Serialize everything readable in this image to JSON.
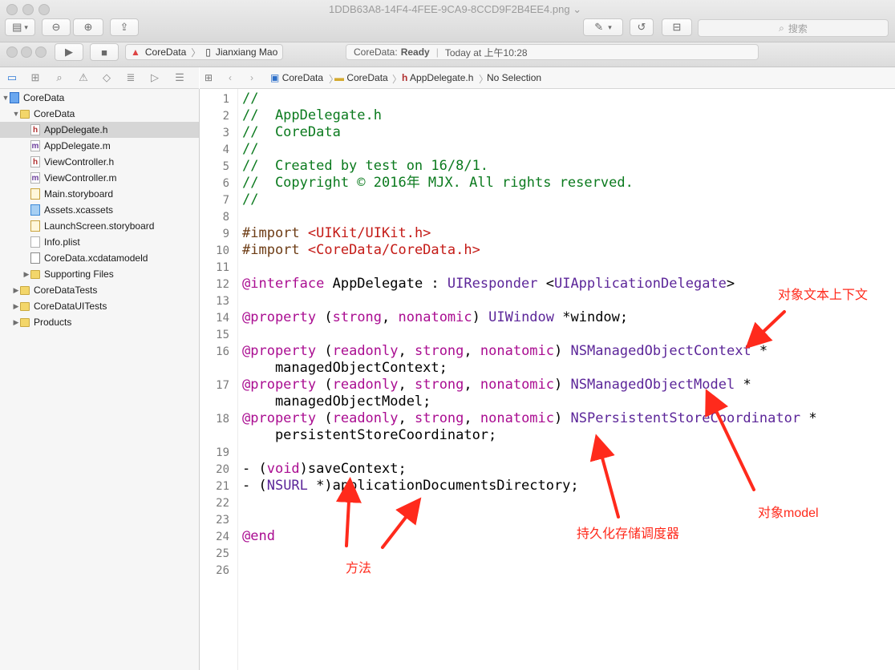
{
  "window": {
    "title": "1DDB63A8-14F4-4FEE-9CA9-8CCD9F2B4EE4.png",
    "title_chevron": "⌄",
    "search_placeholder": "搜索"
  },
  "toolbar": {
    "scheme_target": "CoreData",
    "scheme_device": "Jianxiang Mao",
    "activity_project": "CoreData:",
    "activity_status": "Ready",
    "activity_time": "Today at 上午10:28"
  },
  "navigator": {
    "items": [
      {
        "label": "CoreData",
        "icon": "project-icon",
        "indent": 0,
        "expanded": true
      },
      {
        "label": "CoreData",
        "icon": "folder-icon",
        "indent": 1,
        "expanded": true
      },
      {
        "label": "AppDelegate.h",
        "icon": "header-file-icon",
        "indent": 2,
        "selected": true
      },
      {
        "label": "AppDelegate.m",
        "icon": "source-file-icon",
        "indent": 2
      },
      {
        "label": "ViewController.h",
        "icon": "header-file-icon",
        "indent": 2
      },
      {
        "label": "ViewController.m",
        "icon": "source-file-icon",
        "indent": 2
      },
      {
        "label": "Main.storyboard",
        "icon": "storyboard-icon",
        "indent": 2
      },
      {
        "label": "Assets.xcassets",
        "icon": "assets-icon",
        "indent": 2
      },
      {
        "label": "LaunchScreen.storyboard",
        "icon": "storyboard-icon",
        "indent": 2
      },
      {
        "label": "Info.plist",
        "icon": "plist-icon",
        "indent": 2
      },
      {
        "label": "CoreData.xcdatamodeld",
        "icon": "datamodel-icon",
        "indent": 2
      },
      {
        "label": "Supporting Files",
        "icon": "folder-icon",
        "indent": 2,
        "expanded": false
      },
      {
        "label": "CoreDataTests",
        "icon": "folder-icon",
        "indent": 1,
        "expanded": false
      },
      {
        "label": "CoreDataUITests",
        "icon": "folder-icon",
        "indent": 1,
        "expanded": false
      },
      {
        "label": "Products",
        "icon": "folder-icon",
        "indent": 1,
        "expanded": false
      }
    ]
  },
  "jumpbar": {
    "crumbs": [
      "CoreData",
      "CoreData",
      "AppDelegate.h",
      "No Selection"
    ]
  },
  "editor": {
    "lines": [
      {
        "n": "1",
        "segs": [
          [
            "cm",
            "//"
          ]
        ]
      },
      {
        "n": "2",
        "segs": [
          [
            "cm",
            "//  AppDelegate.h"
          ]
        ]
      },
      {
        "n": "3",
        "segs": [
          [
            "cm",
            "//  CoreData"
          ]
        ]
      },
      {
        "n": "4",
        "segs": [
          [
            "cm",
            "//"
          ]
        ]
      },
      {
        "n": "5",
        "segs": [
          [
            "cm",
            "//  Created by test on 16/8/1."
          ]
        ]
      },
      {
        "n": "6",
        "segs": [
          [
            "cm",
            "//  Copyright © 2016年 MJX. All rights reserved."
          ]
        ]
      },
      {
        "n": "7",
        "segs": [
          [
            "cm",
            "//"
          ]
        ]
      },
      {
        "n": "8",
        "segs": []
      },
      {
        "n": "9",
        "segs": [
          [
            "pp",
            "#import "
          ],
          [
            "str",
            "<UIKit/UIKit.h>"
          ]
        ]
      },
      {
        "n": "10",
        "segs": [
          [
            "pp",
            "#import "
          ],
          [
            "str",
            "<CoreData/CoreData.h>"
          ]
        ]
      },
      {
        "n": "11",
        "segs": []
      },
      {
        "n": "12",
        "segs": [
          [
            "kw",
            "@interface"
          ],
          [
            "",
            " AppDelegate : "
          ],
          [
            "ty",
            "UIResponder"
          ],
          [
            "",
            " <"
          ],
          [
            "ty",
            "UIApplicationDelegate"
          ],
          [
            "",
            ">"
          ]
        ]
      },
      {
        "n": "13",
        "segs": []
      },
      {
        "n": "14",
        "segs": [
          [
            "kw",
            "@property"
          ],
          [
            "",
            " ("
          ],
          [
            "kw",
            "strong"
          ],
          [
            "",
            ", "
          ],
          [
            "kw",
            "nonatomic"
          ],
          [
            "",
            ") "
          ],
          [
            "ty",
            "UIWindow"
          ],
          [
            "",
            " *window;"
          ]
        ]
      },
      {
        "n": "15",
        "segs": []
      },
      {
        "n": "16",
        "segs": [
          [
            "kw",
            "@property"
          ],
          [
            "",
            " ("
          ],
          [
            "kw",
            "readonly"
          ],
          [
            "",
            ", "
          ],
          [
            "kw",
            "strong"
          ],
          [
            "",
            ", "
          ],
          [
            "kw",
            "nonatomic"
          ],
          [
            "",
            ") "
          ],
          [
            "ty",
            "NSManagedObjectContext"
          ],
          [
            "",
            " *"
          ]
        ],
        "wrap": "    managedObjectContext;"
      },
      {
        "n": "17",
        "segs": [
          [
            "kw",
            "@property"
          ],
          [
            "",
            " ("
          ],
          [
            "kw",
            "readonly"
          ],
          [
            "",
            ", "
          ],
          [
            "kw",
            "strong"
          ],
          [
            "",
            ", "
          ],
          [
            "kw",
            "nonatomic"
          ],
          [
            "",
            ") "
          ],
          [
            "ty",
            "NSManagedObjectModel"
          ],
          [
            "",
            " *"
          ]
        ],
        "wrap": "    managedObjectModel;"
      },
      {
        "n": "18",
        "segs": [
          [
            "kw",
            "@property"
          ],
          [
            "",
            " ("
          ],
          [
            "kw",
            "readonly"
          ],
          [
            "",
            ", "
          ],
          [
            "kw",
            "strong"
          ],
          [
            "",
            ", "
          ],
          [
            "kw",
            "nonatomic"
          ],
          [
            "",
            ") "
          ],
          [
            "ty",
            "NSPersistentStoreCoordinator"
          ],
          [
            "",
            " *"
          ]
        ],
        "wrap": "    persistentStoreCoordinator;"
      },
      {
        "n": "19",
        "segs": []
      },
      {
        "n": "20",
        "segs": [
          [
            "",
            "- ("
          ],
          [
            "kw",
            "void"
          ],
          [
            "",
            ")saveContext;"
          ]
        ]
      },
      {
        "n": "21",
        "segs": [
          [
            "",
            "- ("
          ],
          [
            "ty",
            "NSURL"
          ],
          [
            "",
            " *)applicationDocumentsDirectory;"
          ]
        ]
      },
      {
        "n": "22",
        "segs": []
      },
      {
        "n": "23",
        "segs": []
      },
      {
        "n": "24",
        "segs": [
          [
            "kw",
            "@end"
          ]
        ]
      },
      {
        "n": "25",
        "segs": []
      },
      {
        "n": "26",
        "segs": []
      }
    ]
  },
  "annotations": {
    "context": "对象文本上下文",
    "model": "对象model",
    "coordinator": "持久化存储调度器",
    "method": "方法"
  },
  "colors": {
    "annotation": "#ff2a1c",
    "comment": "#0b7a1e",
    "keyword": "#aa0d91",
    "type": "#5c2699",
    "string": "#c41a16",
    "preprocessor": "#6d3c15"
  }
}
